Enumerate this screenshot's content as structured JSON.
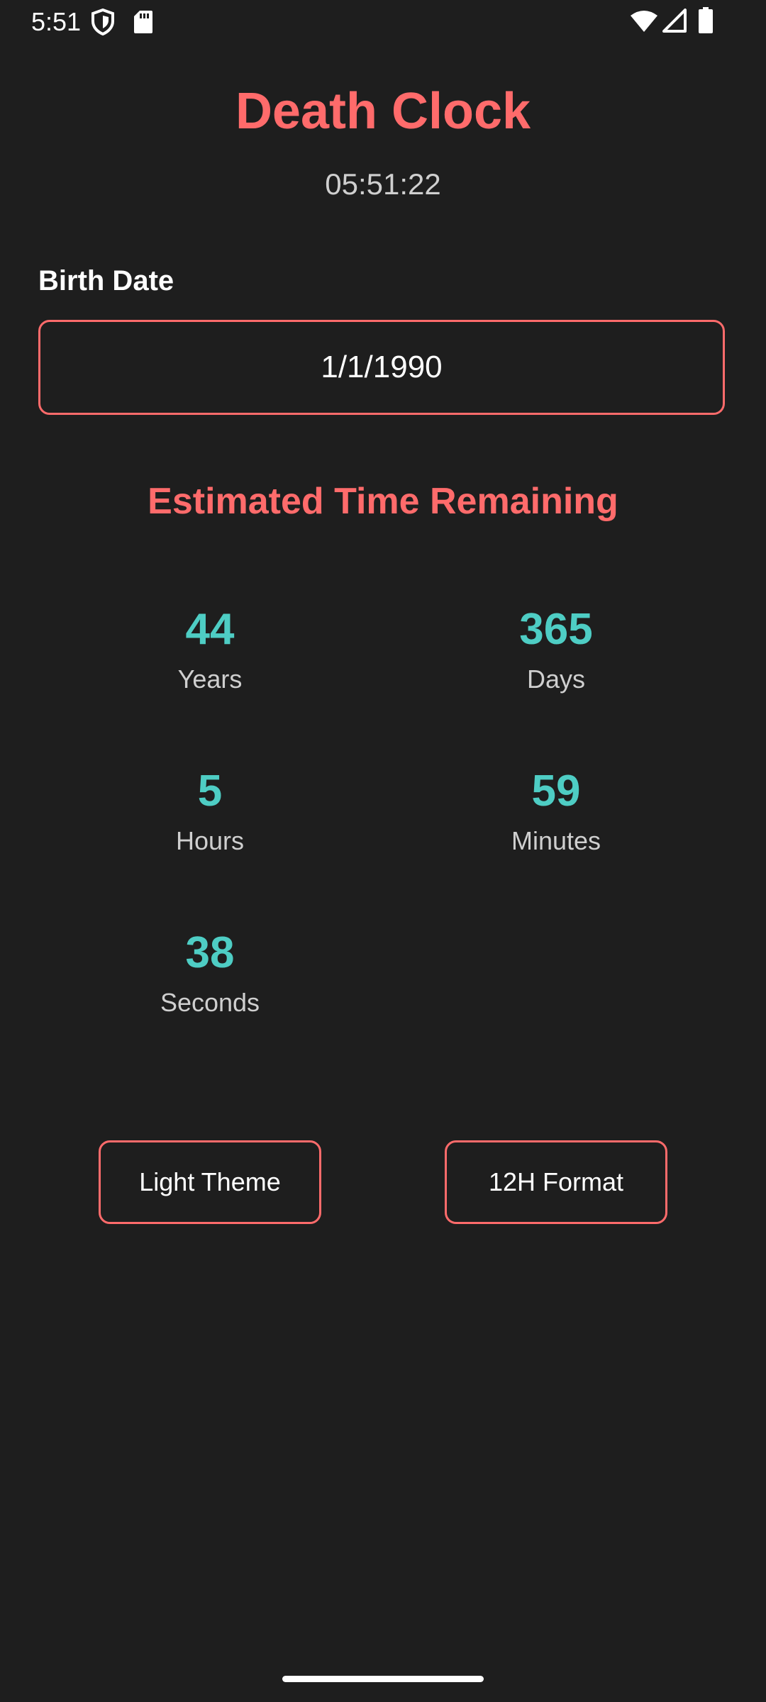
{
  "status_bar": {
    "time": "5:51",
    "left_icons": [
      "shield-icon",
      "sd-card-icon"
    ],
    "right_icons": [
      "wifi-icon",
      "signal-icon",
      "battery-icon"
    ]
  },
  "app": {
    "title": "Death Clock",
    "current_time": "05:51:22"
  },
  "birth_date": {
    "label": "Birth Date",
    "value": "1/1/1990"
  },
  "remaining": {
    "title": "Estimated Time Remaining",
    "years": {
      "value": "44",
      "label": "Years"
    },
    "days": {
      "value": "365",
      "label": "Days"
    },
    "hours": {
      "value": "5",
      "label": "Hours"
    },
    "minutes": {
      "value": "59",
      "label": "Minutes"
    },
    "seconds": {
      "value": "38",
      "label": "Seconds"
    }
  },
  "buttons": {
    "theme": "Light Theme",
    "format": "12H Format"
  },
  "colors": {
    "background": "#1e1e1e",
    "accent": "#ff6b6b",
    "value": "#4ecdc4"
  }
}
